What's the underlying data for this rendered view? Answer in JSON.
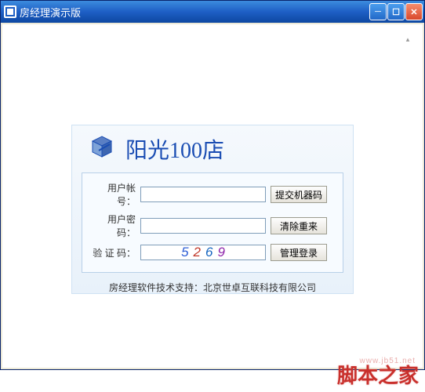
{
  "window": {
    "title": "房经理演示版"
  },
  "login": {
    "shop_title": "阳光100店",
    "labels": {
      "username": "用户帐号：",
      "password": "用户密码：",
      "captcha": "验 证 码："
    },
    "captcha": {
      "d1": "5",
      "d2": "2",
      "d3": "6",
      "d4": "9"
    },
    "buttons": {
      "submit_machine": "提交机器码",
      "clear_reset": "清除重来",
      "admin_login": "管理登录"
    }
  },
  "footer": "房经理软件技术支持：北京世卓互联科技有限公司",
  "watermark": {
    "text": "脚本之家",
    "url": "www.jb51.net"
  }
}
